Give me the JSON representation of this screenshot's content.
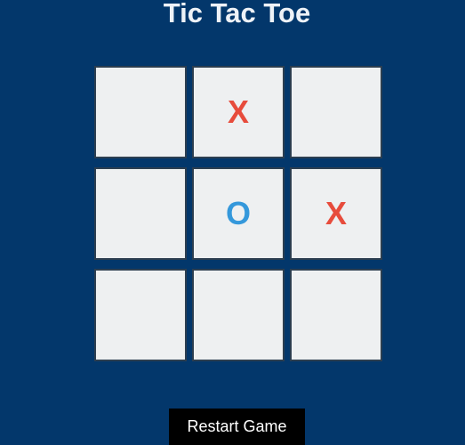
{
  "title": "Tic Tac Toe",
  "board": [
    [
      "",
      "X",
      ""
    ],
    [
      "",
      "O",
      "X"
    ],
    [
      "",
      "",
      ""
    ]
  ],
  "restart_label": "Restart Game",
  "colors": {
    "background": "#03376b",
    "cell": "#eef0f1",
    "x": "#e74c3c",
    "o": "#3498db",
    "button": "#000000"
  }
}
